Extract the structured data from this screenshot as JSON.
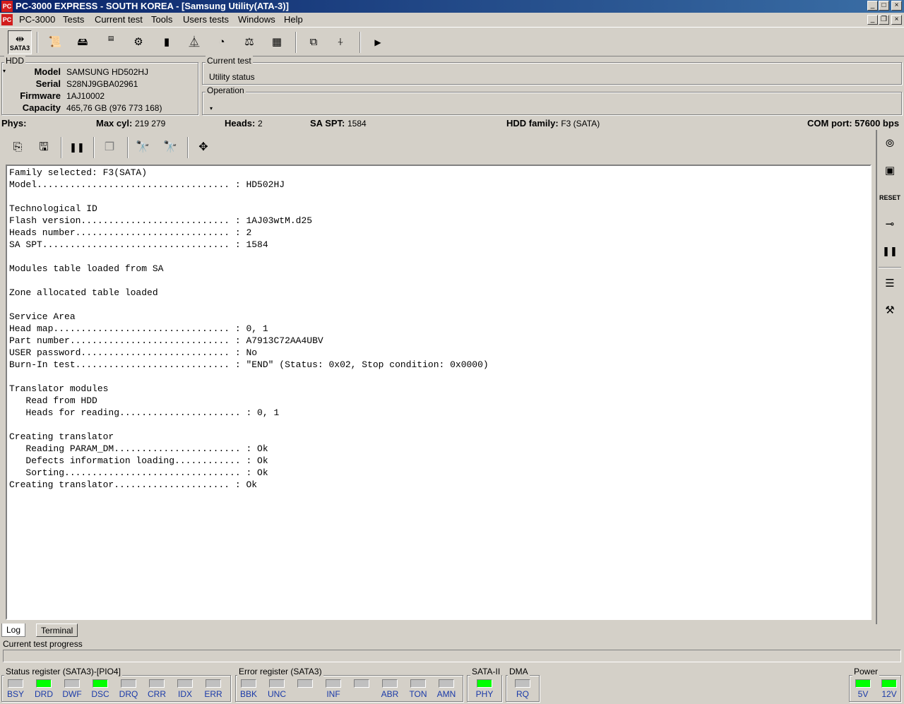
{
  "window": {
    "title": "PC-3000 EXPRESS - SOUTH KOREA - [Samsung Utility(ATA-3)]",
    "app_icon": "app-logo-icon"
  },
  "menu": [
    "PC-3000",
    "Tests",
    "Current test",
    "Tools",
    "Users tests",
    "Windows",
    "Help"
  ],
  "toolbar": {
    "sata_label": "SATA3"
  },
  "hdd": {
    "group_label": "HDD",
    "model_label": "Model",
    "model": "SAMSUNG HD502HJ",
    "serial_label": "Serial",
    "serial": "S28NJ9GBA02961",
    "firmware_label": "Firmware",
    "firmware": "1AJ10002",
    "capacity_label": "Capacity",
    "capacity": "465,76 GB (976 773 168)"
  },
  "current_test": {
    "group_label": "Current test",
    "value": "Utility status",
    "operation_label": "Operation"
  },
  "status_line": {
    "phys_label": "Phys:",
    "maxcyl_label": "Max cyl:",
    "maxcyl": "219 279",
    "heads_label": "Heads:",
    "heads": "2",
    "saspt_label": "SA SPT:",
    "saspt": "1584",
    "family_label": "HDD family:",
    "family": "F3 (SATA)",
    "com_label": "COM port:",
    "com": "57600 bps"
  },
  "log_lines": [
    "Family selected: F3(SATA)",
    "Model................................... : HD502HJ",
    "",
    "Technological ID",
    "Flash version........................... : 1AJ03wtM.d25",
    "Heads number............................ : 2",
    "SA SPT.................................. : 1584",
    "",
    "Modules table loaded from SA",
    "",
    "Zone allocated table loaded",
    "",
    "Service Area",
    "Head map................................ : 0, 1",
    "Part number............................. : A7913C72AA4UBV",
    "USER password........................... : No",
    "Burn-In test............................ : \"END\" (Status: 0x02, Stop condition: 0x0000)",
    "",
    "Translator modules",
    "   Read from HDD",
    "   Heads for reading...................... : 0, 1",
    "",
    "Creating translator",
    "   Reading PARAM_DM....................... : Ok",
    "   Defects information loading............ : Ok",
    "   Sorting................................ : Ok",
    "Creating translator..................... : Ok"
  ],
  "tabs": [
    "Log",
    "Terminal"
  ],
  "progress_label": "Current test progress",
  "status_register": {
    "label": "Status register (SATA3)-[PIO4]",
    "leds": [
      {
        "name": "BSY",
        "on": false
      },
      {
        "name": "DRD",
        "on": true
      },
      {
        "name": "DWF",
        "on": false
      },
      {
        "name": "DSC",
        "on": true
      },
      {
        "name": "DRQ",
        "on": false
      },
      {
        "name": "CRR",
        "on": false
      },
      {
        "name": "IDX",
        "on": false
      },
      {
        "name": "ERR",
        "on": false
      }
    ]
  },
  "error_register": {
    "label": "Error register (SATA3)",
    "leds": [
      {
        "name": "BBK",
        "on": false
      },
      {
        "name": "UNC",
        "on": false
      },
      {
        "name": "",
        "on": false
      },
      {
        "name": "INF",
        "on": false
      },
      {
        "name": "",
        "on": false
      },
      {
        "name": "ABR",
        "on": false
      },
      {
        "name": "TON",
        "on": false
      },
      {
        "name": "AMN",
        "on": false
      }
    ]
  },
  "sata2": {
    "label": "SATA-II",
    "led_name": "PHY",
    "on": true
  },
  "dma": {
    "label": "DMA",
    "led_name": "RQ",
    "on": false
  },
  "power": {
    "label": "Power",
    "leds": [
      {
        "name": "5V",
        "on": true
      },
      {
        "name": "12V",
        "on": true
      }
    ]
  },
  "colors": {
    "led_on": "#00ff00",
    "led_off": "#c0c0c0",
    "title_bg": "#0a246a",
    "led_label": "#1a3aa8"
  }
}
